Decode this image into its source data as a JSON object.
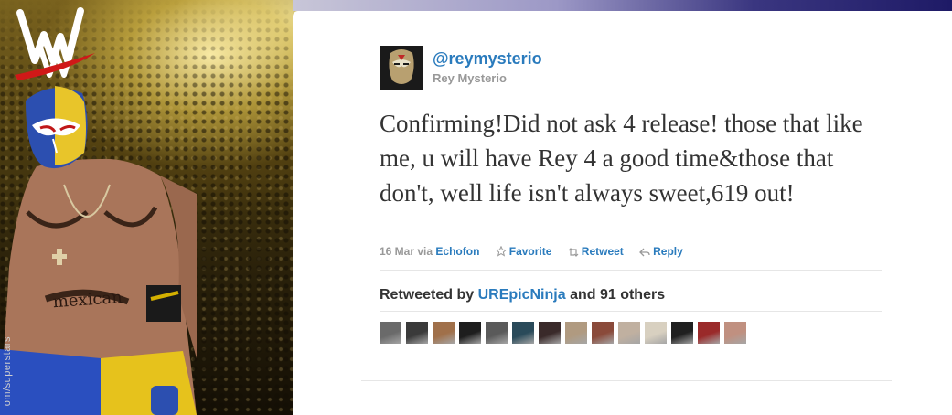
{
  "background": {
    "credit_text": "om/superstars",
    "logo": "wwe-logo"
  },
  "tweet": {
    "handle": "@reymysterio",
    "name": "Rey Mysterio",
    "text": "Confirming!Did not ask 4 release! those that like me, u will have Rey 4 a good time&those that don't, well life isn't always sweet,619 out!",
    "date": "16 Mar",
    "via_label": "via",
    "source": "Echofon",
    "actions": [
      {
        "label": "Favorite",
        "icon": "star-icon"
      },
      {
        "label": "Retweet",
        "icon": "retweet-icon"
      },
      {
        "label": "Reply",
        "icon": "reply-icon"
      }
    ]
  },
  "retweets": {
    "prefix": "Retweeted by",
    "user": "UREpicNinja",
    "suffix": "and 91 others",
    "avatar_colors": [
      "#6a6a6a",
      "#3a3a3a",
      "#a0704a",
      "#1e1e1e",
      "#5a5a5a",
      "#2a4a5a",
      "#3a2a2a",
      "#b09a80",
      "#8a4a3a",
      "#c0b0a0",
      "#d8d0c0",
      "#202020",
      "#9a2a2a",
      "#c09080"
    ]
  },
  "colors": {
    "link": "#2a7bbd",
    "muted": "#999999",
    "text": "#333333"
  }
}
